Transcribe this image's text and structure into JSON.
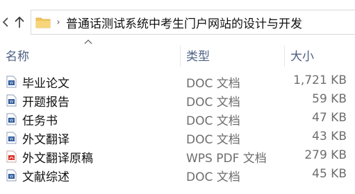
{
  "address": {
    "path": "普通话测试系统中考生门户网站的设计与开发"
  },
  "columns": {
    "name": "名称",
    "type": "类型",
    "size": "大小"
  },
  "files": [
    {
      "name": "毕业论文",
      "type": "DOC 文档",
      "size": "1,721 KB",
      "icon": "word-doc-icon"
    },
    {
      "name": "开题报告",
      "type": "DOC 文档",
      "size": "59 KB",
      "icon": "word-doc-icon"
    },
    {
      "name": "任务书",
      "type": "DOC 文档",
      "size": "47 KB",
      "icon": "word-doc-icon"
    },
    {
      "name": "外文翻译",
      "type": "DOC 文档",
      "size": "43 KB",
      "icon": "word-doc-icon"
    },
    {
      "name": "外文翻译原稿",
      "type": "WPS PDF 文档",
      "size": "279 KB",
      "icon": "pdf-icon"
    },
    {
      "name": "文献综述",
      "type": "DOC 文档",
      "size": "45 KB",
      "icon": "word-doc-icon"
    }
  ],
  "colors": {
    "header_text": "#4d6082",
    "doc_icon": "#2b579a",
    "pdf_icon": "#d9342b",
    "folder": "#f2c55c"
  }
}
